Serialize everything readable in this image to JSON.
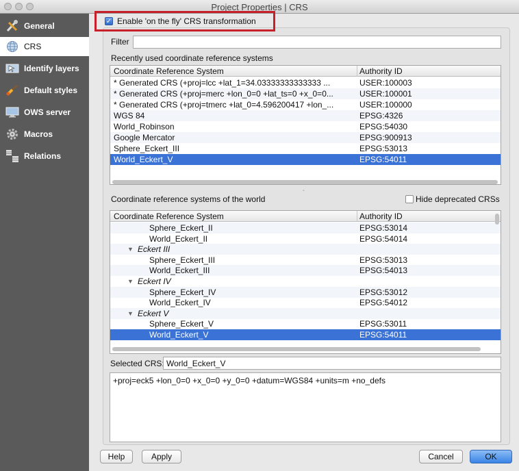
{
  "window": {
    "title": "Project Properties | CRS"
  },
  "sidebar": {
    "items": [
      {
        "label": "General",
        "icon": "wrench-screwdriver-icon"
      },
      {
        "label": "CRS",
        "icon": "globe-icon"
      },
      {
        "label": "Identify layers",
        "icon": "identify-icon"
      },
      {
        "label": "Default styles",
        "icon": "paintbrush-icon"
      },
      {
        "label": "OWS server",
        "icon": "monitor-icon"
      },
      {
        "label": "Macros",
        "icon": "gear-icon"
      },
      {
        "label": "Relations",
        "icon": "relations-icon"
      }
    ]
  },
  "crs": {
    "enable_otf_label": "Enable 'on the fly' CRS transformation",
    "filter_label": "Filter",
    "filter_value": "",
    "recent_title": "Recently used coordinate reference systems",
    "col_crs": "Coordinate Reference System",
    "col_auth": "Authority ID",
    "recent": [
      {
        "name": " * Generated CRS (+proj=lcc +lat_1=34.03333333333333 ...",
        "auth": "USER:100003"
      },
      {
        "name": " * Generated CRS (+proj=merc +lon_0=0 +lat_ts=0 +x_0=0...",
        "auth": "USER:100001"
      },
      {
        "name": " * Generated CRS (+proj=tmerc +lat_0=4.596200417 +lon_...",
        "auth": "USER:100000"
      },
      {
        "name": "WGS 84",
        "auth": "EPSG:4326"
      },
      {
        "name": "World_Robinson",
        "auth": "EPSG:54030"
      },
      {
        "name": "Google Mercator",
        "auth": "EPSG:900913"
      },
      {
        "name": "Sphere_Eckert_III",
        "auth": "EPSG:53013"
      },
      {
        "name": "World_Eckert_V",
        "auth": "EPSG:54011"
      }
    ],
    "world_title": "Coordinate reference systems of the world",
    "hide_deprecated_label": "Hide deprecated CRSs",
    "world": [
      {
        "name": "Sphere_Eckert_II",
        "auth": "EPSG:53014"
      },
      {
        "name": "World_Eckert_II",
        "auth": "EPSG:54014"
      },
      {
        "name": "Eckert III",
        "auth": ""
      },
      {
        "name": "Sphere_Eckert_III",
        "auth": "EPSG:53013"
      },
      {
        "name": "World_Eckert_III",
        "auth": "EPSG:54013"
      },
      {
        "name": "Eckert IV",
        "auth": ""
      },
      {
        "name": "Sphere_Eckert_IV",
        "auth": "EPSG:53012"
      },
      {
        "name": "World_Eckert_IV",
        "auth": "EPSG:54012"
      },
      {
        "name": "Eckert V",
        "auth": ""
      },
      {
        "name": "Sphere_Eckert_V",
        "auth": "EPSG:53011"
      },
      {
        "name": "World_Eckert_V",
        "auth": "EPSG:54011"
      }
    ],
    "selected_label": "Selected CRS:",
    "selected_value": "World_Eckert_V",
    "proj4": "+proj=eck5 +lon_0=0 +x_0=0 +y_0=0 +datum=WGS84 +units=m +no_defs"
  },
  "buttons": {
    "help": "Help",
    "apply": "Apply",
    "cancel": "Cancel",
    "ok": "OK"
  },
  "colors": {
    "sidebar_bg": "#5a5a5a",
    "selection": "#3a72d6",
    "highlight_box": "#c8202a"
  }
}
